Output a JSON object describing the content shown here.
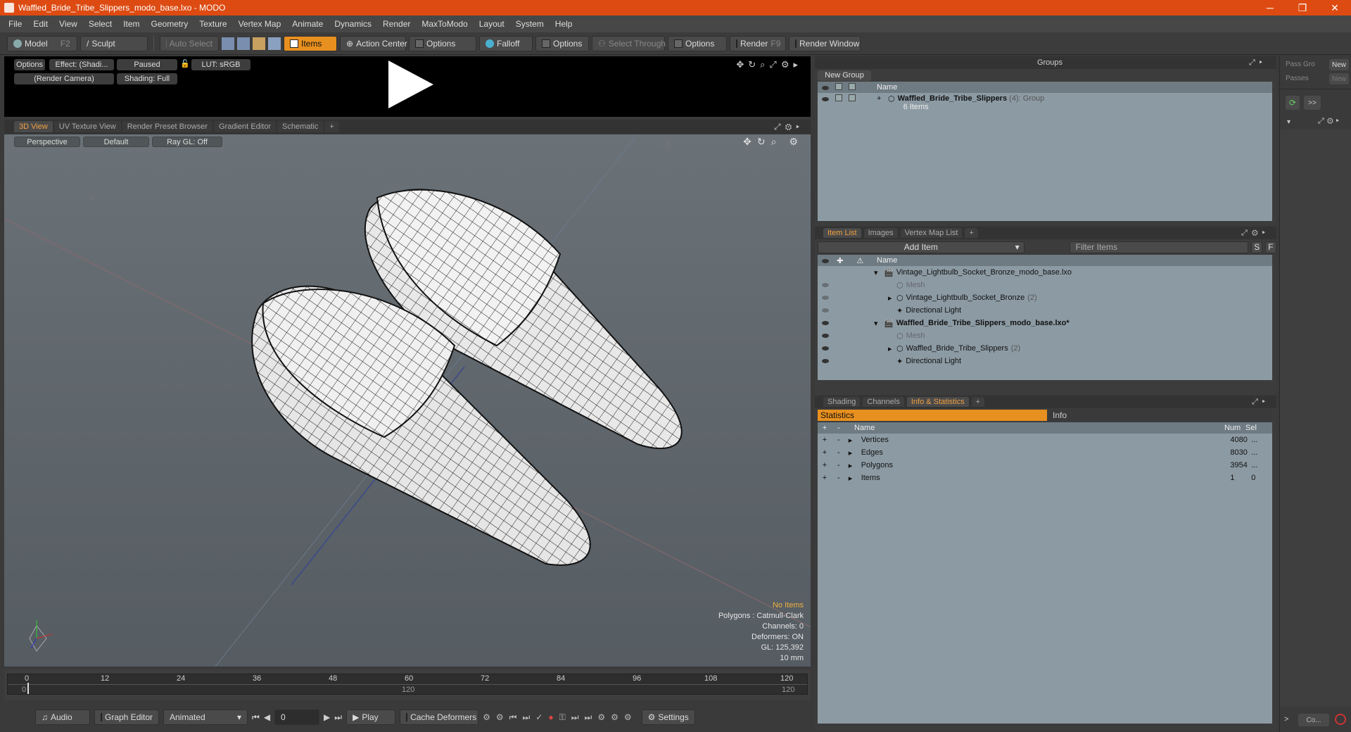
{
  "window": {
    "title": "Waffled_Bride_Tribe_Slippers_modo_base.lxo - MODO",
    "minimize": "─",
    "maximize": "❐",
    "close": "✕"
  },
  "menu": [
    "File",
    "Edit",
    "View",
    "Select",
    "Item",
    "Geometry",
    "Texture",
    "Vertex Map",
    "Animate",
    "Dynamics",
    "Render",
    "MaxToModo",
    "Layout",
    "System",
    "Help"
  ],
  "toolbar": {
    "model": "Model",
    "model_key": "F2",
    "sculpt": "Sculpt",
    "auto_select": "Auto Select",
    "items": "Items",
    "action_center": "Action Center",
    "options1": "Options",
    "falloff": "Falloff",
    "options2": "Options",
    "select_through": "Select Through",
    "options3": "Options",
    "render": "Render",
    "render_key": "F9",
    "render_window": "Render Window"
  },
  "preview": {
    "options": "Options",
    "effect": "Effect: (Shadi...",
    "paused": "Paused",
    "lut": "LUT: sRGB",
    "camera": "(Render Camera)",
    "shading": "Shading: Full"
  },
  "viewport_tabs": [
    "3D View",
    "UV Texture View",
    "Render Preset Browser",
    "Gradient Editor",
    "Schematic",
    "+"
  ],
  "viewport": {
    "perspective": "Perspective",
    "default": "Default",
    "raygl": "Ray GL: Off",
    "axis_x": "-X",
    "axis_z": "-Z"
  },
  "stats_overlay": {
    "no_items": "No Items",
    "polygons": "Polygons : Catmull-Clark",
    "channels": "Channels: 0",
    "deformers": "Deformers: ON",
    "gl": "GL: 125,392",
    "unit": "10 mm"
  },
  "timeline": {
    "ticks": [
      "0",
      "12",
      "24",
      "36",
      "48",
      "60",
      "72",
      "84",
      "96",
      "108",
      "120"
    ],
    "start": "0",
    "mid": "120",
    "end": "120"
  },
  "bottom": {
    "audio": "Audio",
    "graph_editor": "Graph Editor",
    "animated": "Animated",
    "frame": "0",
    "play": "Play",
    "cache": "Cache Deformers",
    "settings": "Settings"
  },
  "groups": {
    "title": "Groups",
    "new_group": "New Group",
    "name_col": "Name",
    "item_name": "Waffled_Bride_Tribe_Slippers",
    "item_count": "(4)",
    "item_type": ": Group",
    "item_sub": "6 Items"
  },
  "passes": {
    "pass_group": "Pass Gro",
    "passes": "Passes",
    "new1": "New",
    "new2": "New",
    "more": ">>"
  },
  "item_list": {
    "tabs": [
      "Item List",
      "Images",
      "Vertex Map List",
      "+"
    ],
    "add_item": "Add Item",
    "filter": "Filter Items",
    "s": "S",
    "f": "F",
    "name_col": "Name",
    "rows": [
      {
        "label": "Vintage_Lightbulb_Socket_Bronze_modo_base.lxo",
        "count": ""
      },
      {
        "label": "Mesh",
        "count": ""
      },
      {
        "label": "Vintage_Lightbulb_Socket_Bronze",
        "count": "(2)"
      },
      {
        "label": "Directional Light",
        "count": ""
      },
      {
        "label": "Waffled_Bride_Tribe_Slippers_modo_base.lxo*",
        "count": ""
      },
      {
        "label": "Mesh",
        "count": ""
      },
      {
        "label": "Waffled_Bride_Tribe_Slippers",
        "count": "(2)"
      },
      {
        "label": "Directional Light",
        "count": ""
      }
    ]
  },
  "info_panel": {
    "tabs": [
      "Shading",
      "Channels",
      "Info & Statistics",
      "+"
    ],
    "statistics": "Statistics",
    "info": "Info",
    "name_col": "Name",
    "num_col": "Num",
    "sel_col": "Sel",
    "rows": [
      {
        "label": "Vertices",
        "num": "4080",
        "sel": "..."
      },
      {
        "label": "Edges",
        "num": "8030",
        "sel": "..."
      },
      {
        "label": "Polygons",
        "num": "3954",
        "sel": "..."
      },
      {
        "label": "Items",
        "num": "1",
        "sel": "0"
      }
    ]
  },
  "bottom_right": {
    "co": "Co..."
  }
}
